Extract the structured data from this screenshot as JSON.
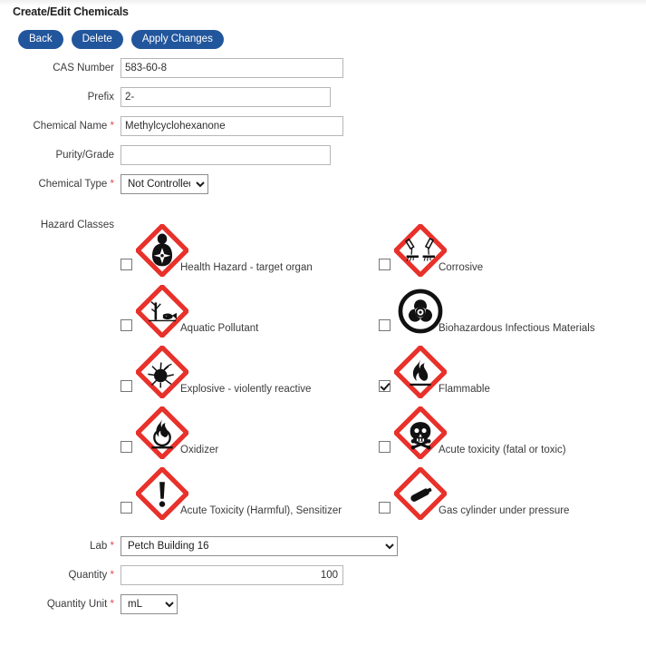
{
  "page": {
    "title": "Create/Edit Chemicals"
  },
  "toolbar": {
    "back_label": "Back",
    "delete_label": "Delete",
    "apply_label": "Apply Changes",
    "button_color": "#22569c"
  },
  "form": {
    "cas_number": {
      "label": "CAS Number",
      "value": "583-60-8",
      "required": false
    },
    "prefix": {
      "label": "Prefix",
      "value": "2-",
      "required": false
    },
    "chemical_name": {
      "label": "Chemical Name",
      "value": "Methylcyclohexanone",
      "required": true,
      "required_marker": "*"
    },
    "purity_grade": {
      "label": "Purity/Grade",
      "value": "",
      "required": false
    },
    "chemical_type": {
      "label": "Chemical Type",
      "value": "Not Controlled",
      "required": true,
      "required_marker": "*",
      "options": [
        "Not Controlled"
      ]
    },
    "lab": {
      "label": "Lab",
      "value": "Petch Building 16",
      "required": true,
      "required_marker": "*",
      "options": [
        "Petch Building 16"
      ]
    },
    "quantity": {
      "label": "Quantity",
      "value": "100",
      "required": true,
      "required_marker": "*"
    },
    "quantity_unit": {
      "label": "Quantity Unit",
      "value": "mL",
      "required": true,
      "required_marker": "*",
      "options": [
        "mL"
      ]
    }
  },
  "hazard_classes": {
    "label": "Hazard Classes",
    "pictogram_border_color": "#e8312a",
    "items": [
      {
        "id": "health-hazard",
        "label": "Health Hazard - target organ",
        "checked": false,
        "icon": "ghs-health-hazard-icon",
        "column": "left",
        "row": 0
      },
      {
        "id": "corrosive",
        "label": "Corrosive",
        "checked": false,
        "icon": "ghs-corrosive-icon",
        "column": "right",
        "row": 0
      },
      {
        "id": "aquatic",
        "label": "Aquatic Pollutant",
        "checked": false,
        "icon": "ghs-environment-icon",
        "column": "left",
        "row": 1
      },
      {
        "id": "biohazard",
        "label": "Biohazardous Infectious Materials",
        "checked": false,
        "icon": "biohazard-icon",
        "column": "right",
        "row": 1
      },
      {
        "id": "explosive",
        "label": "Explosive - violently reactive",
        "checked": false,
        "icon": "ghs-explosive-icon",
        "column": "left",
        "row": 2
      },
      {
        "id": "flammable",
        "label": "Flammable",
        "checked": true,
        "icon": "ghs-flammable-icon",
        "column": "right",
        "row": 2
      },
      {
        "id": "oxidizer",
        "label": "Oxidizer",
        "checked": false,
        "icon": "ghs-oxidizer-icon",
        "column": "left",
        "row": 3
      },
      {
        "id": "acute-toxicity",
        "label": "Acute toxicity (fatal or toxic)",
        "checked": false,
        "icon": "ghs-skull-icon",
        "column": "right",
        "row": 3
      },
      {
        "id": "harmful",
        "label": "Acute Toxicity (Harmful), Sensitizer",
        "checked": false,
        "icon": "ghs-exclamation-icon",
        "column": "left",
        "row": 4
      },
      {
        "id": "gas-cylinder",
        "label": "Gas cylinder under pressure",
        "checked": false,
        "icon": "ghs-gas-cylinder-icon",
        "column": "right",
        "row": 4
      }
    ]
  }
}
